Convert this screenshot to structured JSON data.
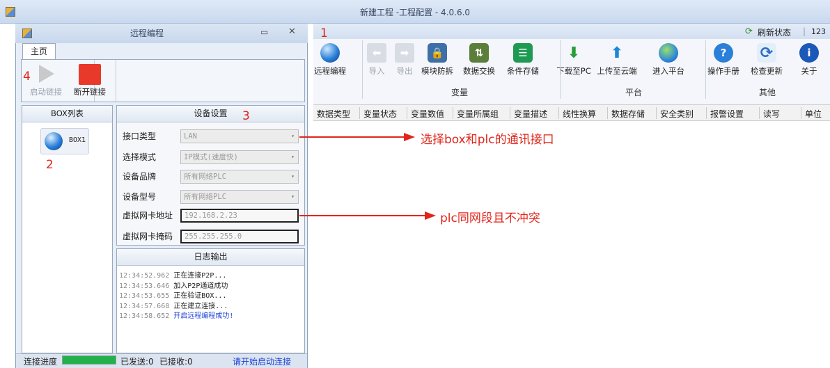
{
  "window": {
    "title": "新建工程 -工程配置 - 4.0.6.0"
  },
  "ribbon": {
    "refresh_label": "刷新状态",
    "right_counter": "123",
    "buttons": [
      {
        "label": "远程编程",
        "icon": "globe-icon"
      },
      {
        "label": "导入",
        "icon": "import-arrow-icon"
      },
      {
        "label": "导出",
        "icon": "export-arrow-icon"
      },
      {
        "label": "模块防拆",
        "icon": "lock-module-icon"
      },
      {
        "label": "数据交换",
        "icon": "swap-icon"
      },
      {
        "label": "条件存储",
        "icon": "list-storage-icon"
      },
      {
        "label": "下载至PC",
        "icon": "download-icon"
      },
      {
        "label": "上传至云端",
        "icon": "upload-icon"
      },
      {
        "label": "进入平台",
        "icon": "platform-globe-icon"
      },
      {
        "label": "操作手册",
        "icon": "help-icon"
      },
      {
        "label": "检查更新",
        "icon": "update-icon"
      },
      {
        "label": "关于",
        "icon": "info-icon"
      }
    ],
    "groups": [
      "变量",
      "平台",
      "其他"
    ]
  },
  "columns": [
    "数据类型",
    "变量状态",
    "变量数值",
    "变量所属组",
    "变量描述",
    "线性换算",
    "数据存储",
    "安全类别",
    "报警设置",
    "读写",
    "单位"
  ],
  "dialog": {
    "title": "远程编程",
    "tab": "主页",
    "start_label": "启动链接",
    "stop_label": "断开链接",
    "box_list_title": "BOX列表",
    "box_name": "BOX1",
    "settings_title": "设备设置",
    "fields": [
      {
        "label": "接口类型",
        "value": "LAN"
      },
      {
        "label": "选择模式",
        "value": "IP模式(速度快)"
      },
      {
        "label": "设备品牌",
        "value": "所有网络PLC"
      },
      {
        "label": "设备型号",
        "value": "所有网络PLC"
      },
      {
        "label": "虚拟网卡地址",
        "value": "192.168.2.23"
      },
      {
        "label": "虚拟网卡掩码",
        "value": "255.255.255.0"
      }
    ],
    "log_title": "日志输出",
    "log": [
      {
        "time": "12:34:52.962",
        "msg": "正在连接P2P..."
      },
      {
        "time": "12:34:53.646",
        "msg": "加入P2P通道成功"
      },
      {
        "time": "12:34:53.655",
        "msg": "正在验证BOX..."
      },
      {
        "time": "12:34:57.668",
        "msg": "正在建立连接..."
      },
      {
        "time": "12:34:58.652",
        "msg": "开启远程编程成功!"
      }
    ],
    "status": {
      "progress_label": "连接进度",
      "progress": 1.0,
      "sent": "已发送:0",
      "received": "已接收:0",
      "hint": "请开始启动连接"
    }
  },
  "annotations": {
    "markers": [
      "1",
      "2",
      "3",
      "4"
    ],
    "notes": [
      "选择box和plc的通讯接口",
      "plc同网段且不冲突"
    ]
  },
  "colors": {
    "accent_red": "#e0261c",
    "progress_green": "#22b14c",
    "success_blue": "#1a3fd6"
  }
}
